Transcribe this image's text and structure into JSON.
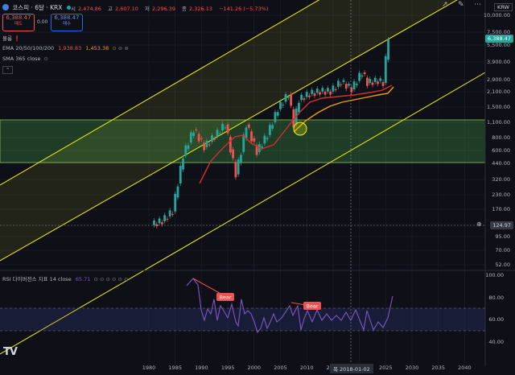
{
  "header": {
    "symbol_icon": "kospi-logo-icon",
    "title": "코스피 · 6달 · KRX",
    "ohlc": [
      {
        "k": "시",
        "v": "2,474.86"
      },
      {
        "k": "고",
        "v": "2,607.10"
      },
      {
        "k": "저",
        "v": "2,296.39"
      },
      {
        "k": "종",
        "v": "2,326.13"
      }
    ],
    "change": "−141.26 (−5.73%)",
    "sell_price": "6,388.47",
    "sell_label": "매도",
    "spread": "0.00",
    "buy_price": "6,388.47",
    "buy_label": "매수",
    "vol_label": "볼륨"
  },
  "indicators": {
    "ema": {
      "label": "EMA 20/50/100/200",
      "v1": "1,938.83",
      "v2": "1,453.38"
    },
    "sma": {
      "label": "SMA 365 close"
    },
    "rsi": {
      "label": "RSI 다이버전스 지표 14 close",
      "value": "65.71"
    }
  },
  "right_axis": {
    "currency": "KRW",
    "price_ticks": [
      "10,000.00",
      "7,500.00",
      "5,500.00",
      "3,900.00",
      "2,900.00",
      "2,100.00",
      "1,500.00",
      "1,100.00",
      "800.00",
      "600.00",
      "440.00",
      "320.00",
      "230.00",
      "170.00",
      "95.00",
      "70.00",
      "52.00"
    ],
    "last_price": "6,388.47",
    "crosshair_price": "124.97",
    "rsi_ticks": [
      "100.00",
      "80.00",
      "60.00",
      "40.00"
    ]
  },
  "time_axis": {
    "ticks": [
      "1980",
      "1985",
      "1990",
      "1995",
      "2000",
      "2005",
      "2010",
      "2015",
      "2020",
      "2025",
      "2030",
      "2035",
      "2040"
    ],
    "crosshair_date": "목 2018-01-02"
  },
  "annotations": {
    "bear1": "Bear",
    "bear2": "Bear"
  },
  "colors": {
    "bg": "#0f1017",
    "up": "#26a69a",
    "down": "#ef5350",
    "channel": "#f5f500",
    "zone": "#4caf50",
    "ema_red": "#d32f2f",
    "ema_orange": "#f59f00",
    "rsi": "#7e57c2"
  },
  "chart_data": {
    "type": "line",
    "title": "코스피 · 6달 · KRX",
    "x": [
      1981,
      1983,
      1985,
      1987,
      1989,
      1991,
      1993,
      1995,
      1997,
      1998,
      1999,
      2001,
      2003,
      2005,
      2007,
      2008,
      2009,
      2011,
      2013,
      2015,
      2017,
      2019,
      2021,
      2022,
      2024,
      2025,
      2026
    ],
    "series": [
      {
        "name": "close",
        "values": [
          120,
          130,
          160,
          520,
          900,
          620,
          780,
          1000,
          350,
          560,
          1000,
          560,
          800,
          1380,
          1900,
          1000,
          1680,
          1900,
          2000,
          2000,
          2450,
          2100,
          3000,
          2400,
          2500,
          2400,
          6388
        ]
      }
    ],
    "ylim": [
      52,
      10000
    ],
    "log_scale": true,
    "legend": "none"
  }
}
